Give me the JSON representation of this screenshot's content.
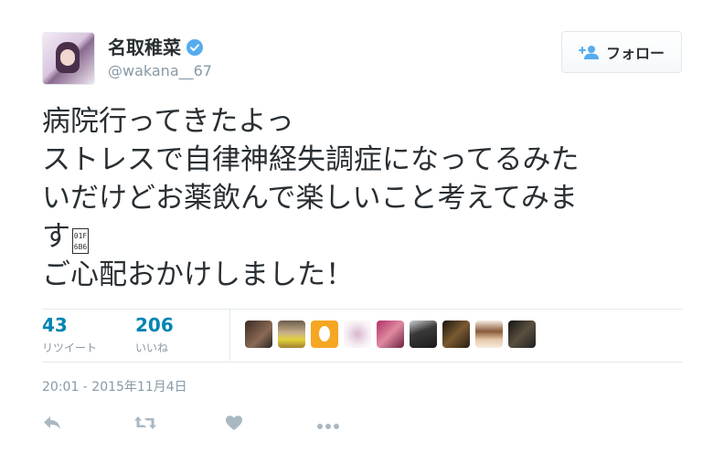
{
  "user": {
    "display_name": "名取稚菜",
    "handle": "@wakana__67",
    "verified": true,
    "verified_icon": "verified-badge-icon"
  },
  "follow_button": {
    "label": "フォロー",
    "icon": "add-user-icon"
  },
  "tweet": {
    "text": "病院行ってきたよっ\nストレスで自律神経失調症になってるみたいだけどお薬飲んで楽しいこと考えてみます\n🚶\nご心配おかけしました！",
    "display_lines": [
      "病院行ってきたよっ",
      "ストレスで自律神経失調症になってるみた",
      "いだけどお薬飲んで楽しいこと考えてみま",
      "す",
      "ご心配おかけしました！"
    ],
    "missing_glyph_code": "01F 6B6"
  },
  "stats": {
    "retweets": {
      "count": "43",
      "label": "リツイート"
    },
    "likes": {
      "count": "206",
      "label": "いいね"
    }
  },
  "likers_count_shown": 9,
  "timestamp": "20:01 - 2015年11月4日",
  "actions": {
    "reply_icon": "reply-icon",
    "retweet_icon": "retweet-icon",
    "like_icon": "heart-icon",
    "more_icon": "more-icon"
  },
  "colors": {
    "link": "#0084b4",
    "muted": "#8899a6",
    "text": "#292f33",
    "verified": "#55acee",
    "action_icon": "#aab8c2"
  }
}
